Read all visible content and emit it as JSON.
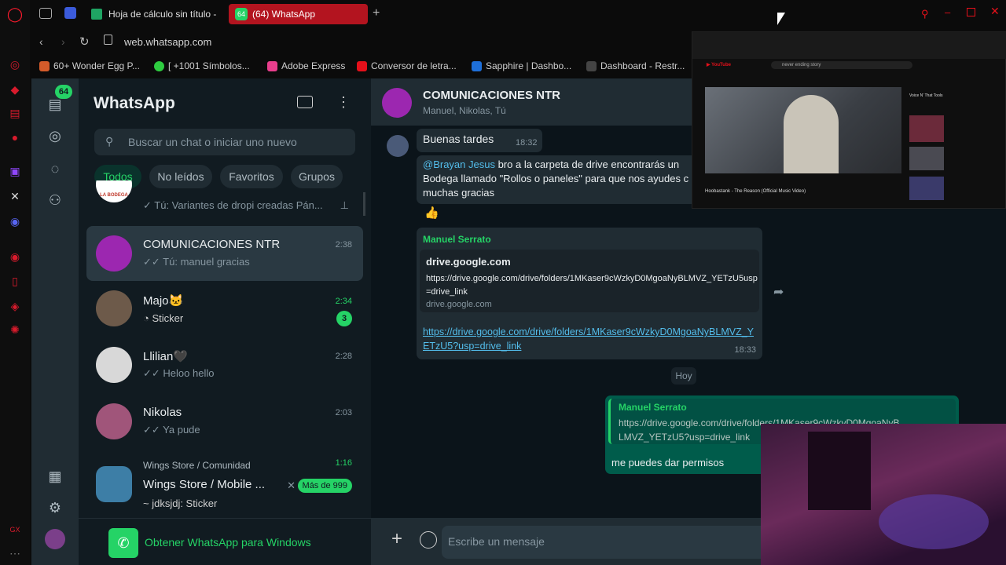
{
  "browser": {
    "tabs": [
      {
        "label": "Hoja de cálculo sin título -"
      },
      {
        "label": "(64) WhatsApp",
        "badge": "64"
      }
    ],
    "url": "web.whatsapp.com",
    "bookmarks": [
      "60+ Wonder Egg P...",
      "[ +1001 Símbolos...",
      "Adobe Express",
      "Conversor de letra...",
      "Sapphire | Dashbo...",
      "Dashboard - Restr..."
    ]
  },
  "whatsapp": {
    "title": "WhatsApp",
    "nav_badge": "64",
    "search_placeholder": "Buscar un chat o iniciar uno nuevo",
    "filters": [
      "Todos",
      "No leídos",
      "Favoritos",
      "Grupos"
    ],
    "chats": [
      {
        "name": "",
        "preview": "Tú: Variantes de dropi creadas Pán...",
        "time": "",
        "avatar_text": "LA BODEGA"
      },
      {
        "name": "COMUNICACIONES NTR",
        "preview": "Tú: manuel gracias",
        "time": "2:38"
      },
      {
        "name": "Majo🐱",
        "preview": "Sticker",
        "time": "2:34",
        "unread": "3"
      },
      {
        "name": "Llilian🖤",
        "preview": "Heloo hello",
        "time": "2:28"
      },
      {
        "name": "Nikolas",
        "preview": "Ya pude",
        "time": "2:03"
      },
      {
        "name": "Wings Store / Mobile ...",
        "community": "Wings Store / Comunidad",
        "preview": "~ jdksjdj: Sticker",
        "time": "1:16",
        "unread": "Más de 999"
      }
    ],
    "get_app": "Obtener WhatsApp para Windows",
    "conversation": {
      "name": "COMUNICACIONES NTR",
      "members": "Manuel, Nikolas, Tú",
      "messages": {
        "m1_text": "Buenas tardes",
        "m1_time": "18:32",
        "m2_mention": "@Brayan Jesus",
        "m2_line1": " bro a la carpeta de drive encontrarás un ",
        "m2_line2": "Bodega llamado \"Rollos o paneles\" para que nos ayudes c",
        "m2_line3": "muchas gracias",
        "m3_reaction": "👍",
        "m4_sender": "Manuel Serrato",
        "m4_preview_title": "drive.google.com",
        "m4_preview_url": "https://drive.google.com/drive/folders/1MKaser9cWzkyD0MgoaNyBLMVZ_YETzU5usp=drive_link",
        "m4_preview_domain": "drive.google.com",
        "m4_link": "https://drive.google.com/drive/folders/1MKaser9cWzkyD0MgoaNyBLMVZ_YETzU5?usp=drive_link",
        "m4_time": "18:33",
        "day_divider": "Hoy",
        "m5_quote_sender": "Manuel Serrato",
        "m5_quote_text": "https://drive.google.com/drive/folders/1MKaser9cWzkyD0MgoaNyBLMVZ_YETzU5?usp=drive_link",
        "m5_text": "me puedes dar permisos"
      },
      "composer_placeholder": "Escribe un mensaje"
    }
  },
  "overlay": {
    "video_title": "Hoobastank - The Reason (Official Music Video)",
    "search_text": "never ending story",
    "side_title": "Voice N' That Tools"
  },
  "colors": {
    "opera_red": "#e5101a",
    "wa_green": "#25d366",
    "wa_dark": "#111b21",
    "tab_active": "#b3141f"
  }
}
